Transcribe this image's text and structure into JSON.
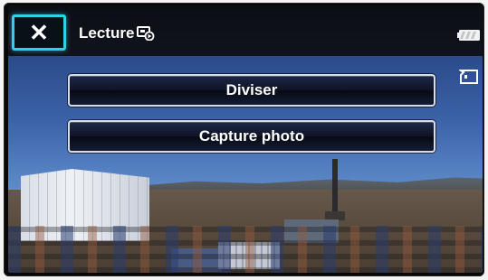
{
  "header": {
    "close_label": "✕",
    "title": "Lecture",
    "title_icon": "playback-slideshow-icon"
  },
  "status": {
    "battery_icon": "battery-icon",
    "memory_card_icon": "memory-card-icon"
  },
  "menu": {
    "items": [
      {
        "label": "Diviser"
      },
      {
        "label": "Capture photo"
      }
    ]
  },
  "colors": {
    "accent": "#2ed0ec",
    "button_border": "#d8dde8",
    "bar_bg": "#0c0e15"
  }
}
